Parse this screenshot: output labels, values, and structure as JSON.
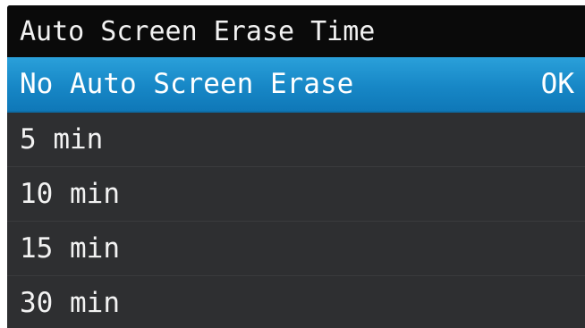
{
  "header": {
    "title": "Auto Screen Erase Time"
  },
  "menu": {
    "items": [
      {
        "label": "No Auto Screen Erase",
        "status": "OK",
        "selected": true
      },
      {
        "label": "5 min"
      },
      {
        "label": "10 min"
      },
      {
        "label": "15 min"
      },
      {
        "label": "30 min"
      }
    ]
  },
  "colors": {
    "title_background": "#0a0a0a",
    "list_background": "#2e2f31",
    "selected_highlight": "#1787c6",
    "text": "#f2f2f2"
  }
}
